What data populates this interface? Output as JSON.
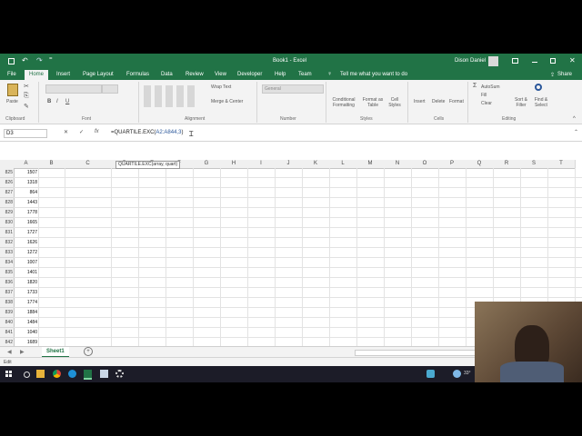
{
  "window": {
    "title": "Book1 - Excel",
    "user": "Dison Daniel",
    "autosave_indicator": "="
  },
  "tabs": [
    "File",
    "Home",
    "Insert",
    "Page Layout",
    "Formulas",
    "Data",
    "Review",
    "View",
    "Developer",
    "Help",
    "Team"
  ],
  "tell_me": "Tell me what you want to do",
  "share": "Share",
  "ribbon": {
    "groups": [
      "Clipboard",
      "Font",
      "Alignment",
      "Number",
      "Styles",
      "Cells",
      "Editing"
    ],
    "paste": "Paste",
    "wrap_text": "Wrap Text",
    "merge_center": "Merge & Center",
    "number_format": "General",
    "conditional_formatting": "Conditional Formatting",
    "format_as_table": "Format as Table",
    "cell_styles": "Cell Styles",
    "insert": "Insert",
    "delete": "Delete",
    "format": "Format",
    "autosum": "AutoSum",
    "fill": "Fill",
    "clear": "Clear",
    "sort_filter": "Sort & Filter",
    "find_select": "Find & Select",
    "bold": "B",
    "italic": "I",
    "underline": "U"
  },
  "formula_bar": {
    "name_box": "D3",
    "formula_prefix": "=QUARTILE.EXC(",
    "formula_ref": "A2:A844,3",
    "formula_suffix": ")",
    "cancel": "✕",
    "enter": "✓",
    "fx": "fx"
  },
  "tooltip": "QUARTILE.EXC(array, quart)",
  "columns": [
    "A",
    "B",
    "C",
    "D",
    "E",
    "F",
    "G",
    "H",
    "I",
    "J",
    "K",
    "L",
    "M",
    "N",
    "O",
    "P",
    "Q",
    "R",
    "S",
    "T"
  ],
  "rows": [
    {
      "num": "825",
      "a": "1507"
    },
    {
      "num": "826",
      "a": "1318"
    },
    {
      "num": "827",
      "a": "864"
    },
    {
      "num": "828",
      "a": "1443"
    },
    {
      "num": "829",
      "a": "1778"
    },
    {
      "num": "830",
      "a": "1665"
    },
    {
      "num": "831",
      "a": "1727"
    },
    {
      "num": "832",
      "a": "1626"
    },
    {
      "num": "833",
      "a": "1272"
    },
    {
      "num": "834",
      "a": "1007"
    },
    {
      "num": "835",
      "a": "1401"
    },
    {
      "num": "836",
      "a": "1820"
    },
    {
      "num": "837",
      "a": "1733"
    },
    {
      "num": "838",
      "a": "1774"
    },
    {
      "num": "839",
      "a": "1884"
    },
    {
      "num": "840",
      "a": "1484"
    },
    {
      "num": "841",
      "a": "1040"
    },
    {
      "num": "842",
      "a": "1689"
    },
    {
      "num": "843",
      "a": "2180"
    },
    {
      "num": "844",
      "a": "2230"
    }
  ],
  "sheet_tab": "Sheet1",
  "add_sheet": "+",
  "status": "Edit",
  "weather": "33°",
  "colors": {
    "excel_green": "#217346",
    "accent_blue": "#2b579a"
  }
}
